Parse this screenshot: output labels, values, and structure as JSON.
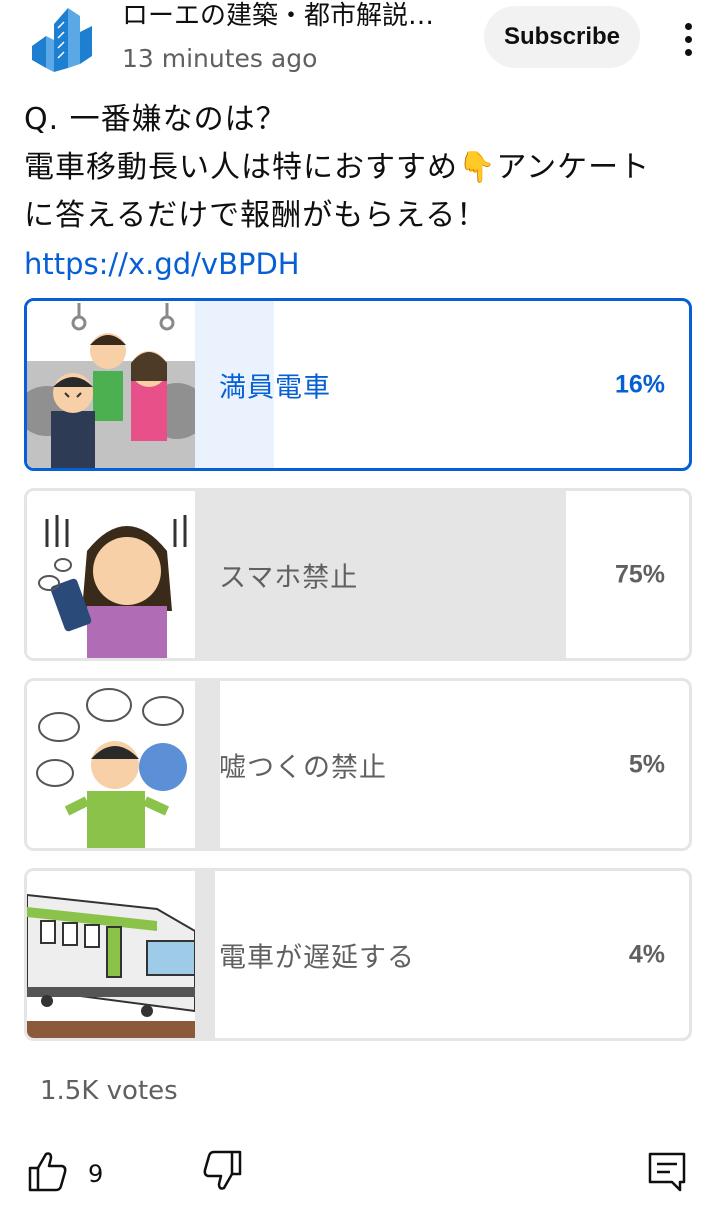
{
  "channel": {
    "name": "ローエの建築・都市解説…",
    "timestamp": "13 minutes ago",
    "subscribe_label": "Subscribe",
    "avatar_icon": "buildings-logo-icon"
  },
  "post": {
    "lines": [
      "Q. 一番嫌なのは？",
      "電車移動長い人は特におすすめ👇アンケート",
      "に答えるだけで報酬がもらえる！"
    ],
    "link": "https://x.gd/vBPDH"
  },
  "poll": {
    "options": [
      {
        "label": "満員電車",
        "percent_text": "16%",
        "percent": 16,
        "selected": true
      },
      {
        "label": "スマホ禁止",
        "percent_text": "75%",
        "percent": 75,
        "selected": false
      },
      {
        "label": "嘘つくの禁止",
        "percent_text": "5%",
        "percent": 5,
        "selected": false
      },
      {
        "label": "電車が遅延する",
        "percent_text": "4%",
        "percent": 4,
        "selected": false
      }
    ],
    "votes": "1.5K votes"
  },
  "actions": {
    "like_count": "9",
    "like_icon": "thumbs-up-icon",
    "dislike_icon": "thumbs-down-icon",
    "comment_icon": "comment-icon"
  },
  "colors": {
    "accent": "#065fd4",
    "selected_fill": "#eaf3fd",
    "fill": "#e5e5e5",
    "muted_text": "#606060"
  }
}
